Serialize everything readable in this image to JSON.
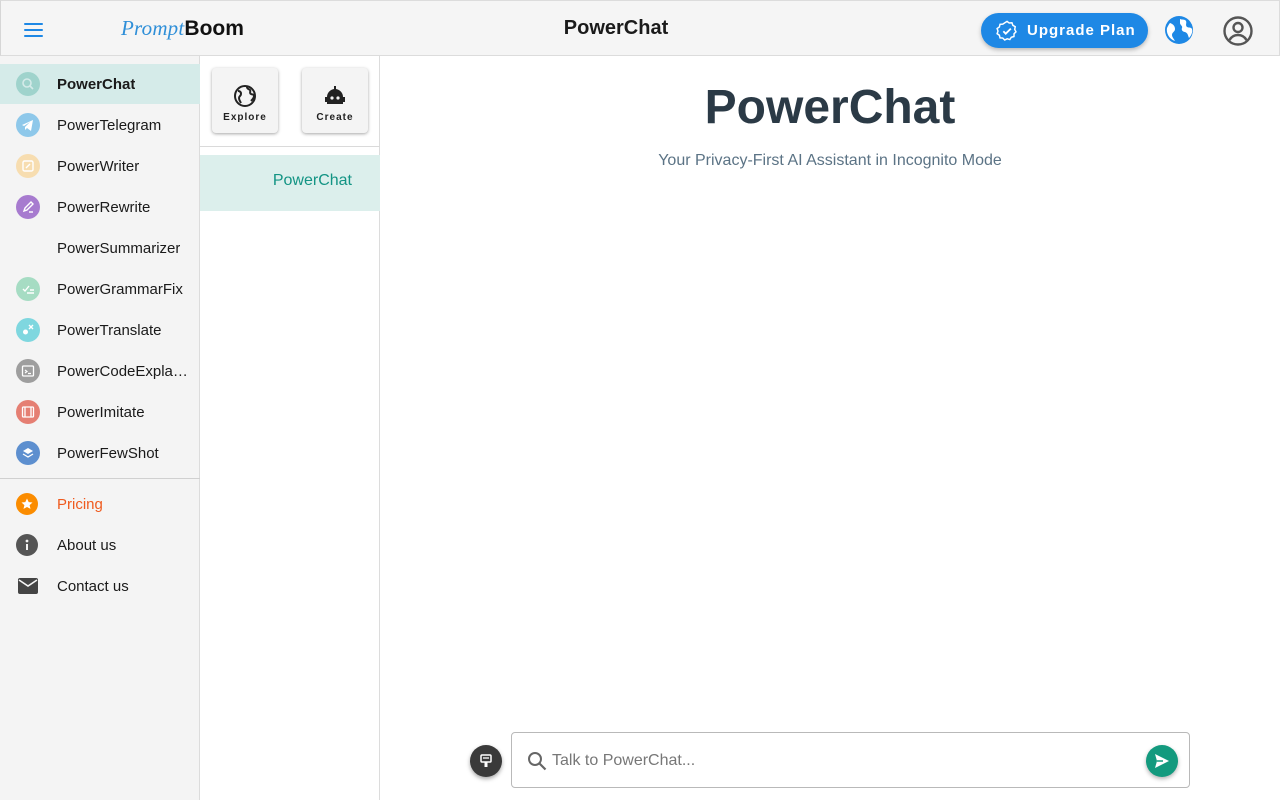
{
  "header": {
    "logo_part1": "Prompt",
    "logo_part2": "Boom",
    "title": "PowerChat",
    "upgrade_label": "Upgrade Plan",
    "icons": [
      "menu-icon",
      "verified-badge-icon",
      "globe-icon",
      "account-circle-icon"
    ],
    "accent_color": "#1e88e5"
  },
  "sidebar": {
    "items": [
      {
        "label": "PowerChat",
        "icon": "chat-icon",
        "color": "#9fd3cc",
        "active": true
      },
      {
        "label": "PowerTelegram",
        "icon": "telegram-icon",
        "color": "#8ec8ea"
      },
      {
        "label": "PowerWriter",
        "icon": "writer-icon",
        "color": "#f7ddb0"
      },
      {
        "label": "PowerRewrite",
        "icon": "pencil-icon",
        "color": "#a77bcf"
      },
      {
        "label": "PowerSummarizer",
        "icon": "summarizer-icon",
        "color": "#f4f4f4"
      },
      {
        "label": "PowerGrammarFix",
        "icon": "grammar-check-icon",
        "color": "#a6dcc3"
      },
      {
        "label": "PowerTranslate",
        "icon": "translate-icon",
        "color": "#7fd7df"
      },
      {
        "label": "PowerCodeExplainer",
        "display_label": "PowerCodeExpla…",
        "icon": "code-terminal-icon",
        "color": "#9e9e9e"
      },
      {
        "label": "PowerImitate",
        "icon": "film-icon",
        "color": "#e57f73"
      },
      {
        "label": "PowerFewShot",
        "icon": "layers-icon",
        "color": "#5d8fcf"
      }
    ],
    "footer_items": [
      {
        "label": "Pricing",
        "icon": "star-icon",
        "color": "#fb8c00",
        "text_color": "#ef5b1f"
      },
      {
        "label": "About us",
        "icon": "info-icon",
        "color": "#555555"
      },
      {
        "label": "Contact us",
        "icon": "mail-icon",
        "color": "#444444"
      }
    ]
  },
  "midcol": {
    "explore_label": "Explore",
    "create_label": "Create",
    "chat_entry": "PowerChat"
  },
  "main": {
    "title": "PowerChat",
    "subtitle": "Your Privacy-First AI Assistant in Incognito Mode"
  },
  "composer": {
    "placeholder": "Talk to PowerChat...",
    "value": "",
    "send_color": "#139a7e"
  }
}
